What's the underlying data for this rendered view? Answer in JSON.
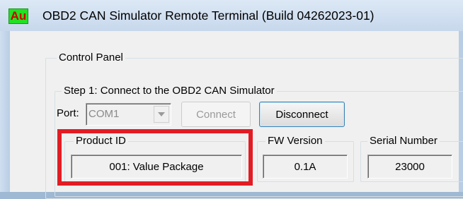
{
  "window": {
    "app_icon_text": "Au",
    "title": "OBD2 CAN Simulator Remote Terminal (Build 04262023-01)"
  },
  "control_panel": {
    "legend": "Control Panel",
    "step1": {
      "legend": "Step 1: Connect to the OBD2 CAN Simulator",
      "port_label": "Port:",
      "port_value": "COM1",
      "connect_label": "Connect",
      "disconnect_label": "Disconnect"
    },
    "product_id": {
      "legend": "Product ID",
      "value": "001: Value Package"
    },
    "fw_version": {
      "legend": "FW Version",
      "value": "0.1A"
    },
    "serial_number": {
      "legend": "Serial Number",
      "value": "23000"
    }
  },
  "colors": {
    "highlight": "#e21c24",
    "title_bar": "#c7d8ec",
    "app_icon_bg": "#22e022",
    "app_icon_text": "#cc0000"
  }
}
